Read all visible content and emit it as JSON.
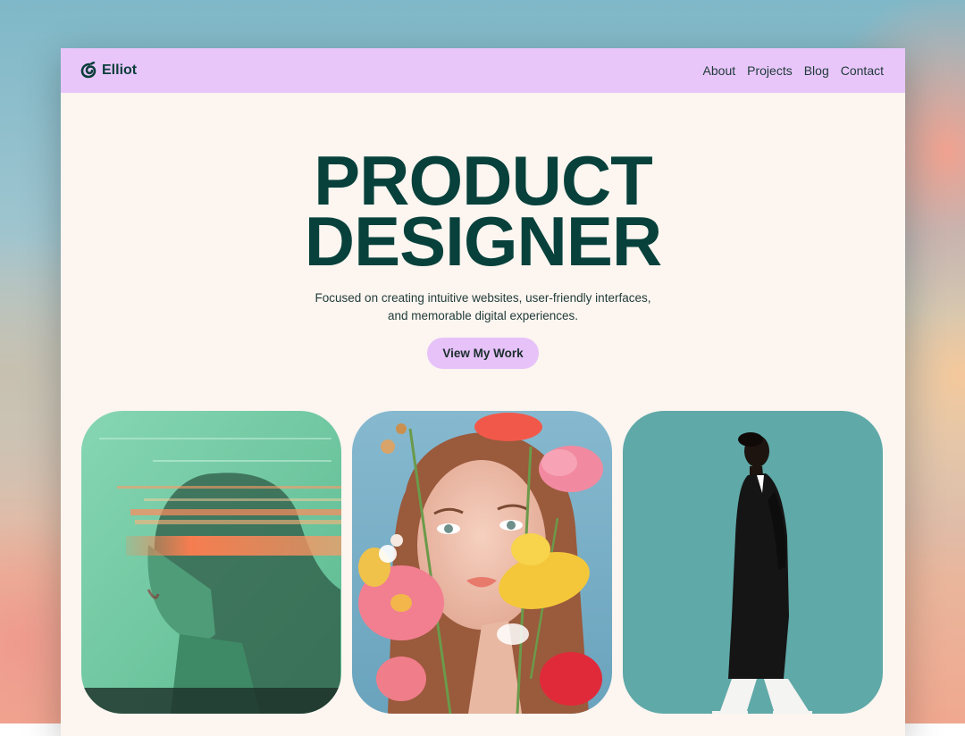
{
  "brand": {
    "name": "Elliot",
    "logo_icon": "spiral-logo-icon"
  },
  "nav": {
    "items": [
      {
        "label": "About"
      },
      {
        "label": "Projects"
      },
      {
        "label": "Blog"
      },
      {
        "label": "Contact"
      }
    ]
  },
  "hero": {
    "title_line1": "PRODUCT",
    "title_line2": "DESIGNER",
    "subtitle_line1": "Focused on creating intuitive websites, user-friendly interfaces,",
    "subtitle_line2": "and memorable digital experiences.",
    "cta_label": "View My Work"
  },
  "gallery": {
    "images": [
      {
        "name": "motion-blur-portrait-image"
      },
      {
        "name": "flower-portrait-image"
      },
      {
        "name": "walking-model-image"
      }
    ]
  },
  "colors": {
    "nav_bg": "#e8c6fa",
    "page_bg": "#fcf5f0",
    "heading": "#08413b",
    "cta_bg": "#e6c2f9"
  }
}
